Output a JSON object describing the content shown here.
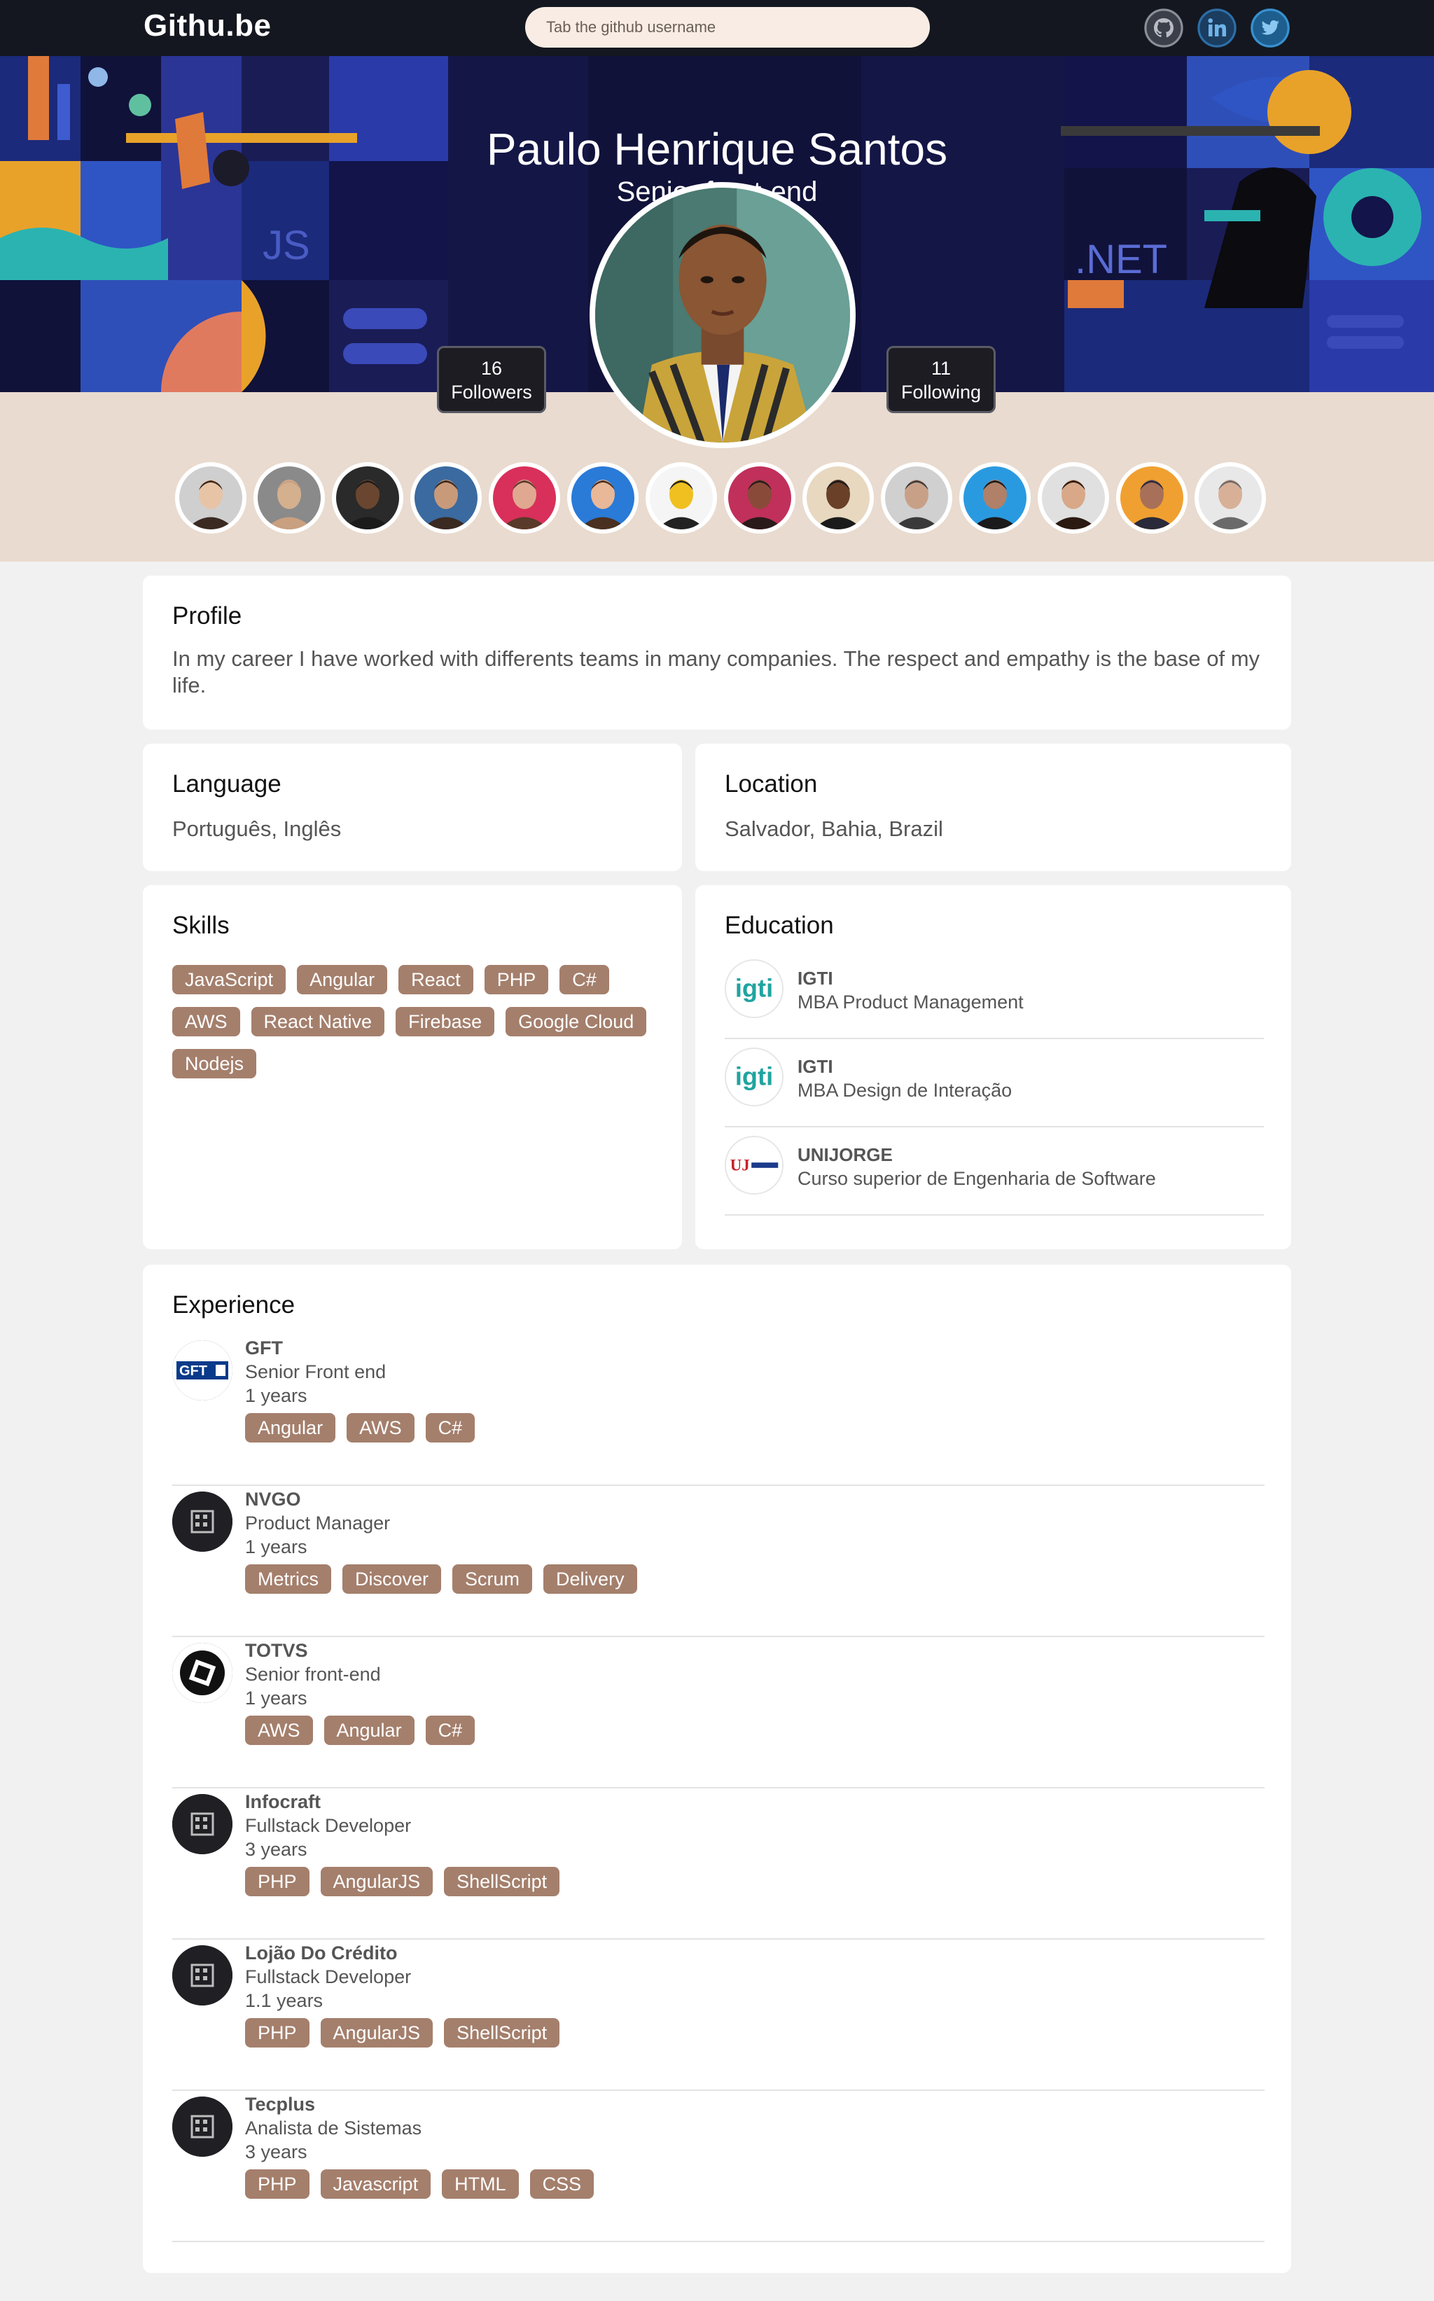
{
  "nav": {
    "brand": "Githu.be",
    "search_placeholder": "Tab the github username"
  },
  "social": [
    "github-icon",
    "linkedin-icon",
    "twitter-icon"
  ],
  "hero": {
    "name": "Paulo Henrique Santos",
    "role": "Senior front-end",
    "art_labels": [
      "JS",
      ".NET"
    ]
  },
  "stats": {
    "followers_count": "16",
    "followers_label": "Followers",
    "following_count": "11",
    "following_label": "Following"
  },
  "follower_avatars": 14,
  "profile": {
    "title": "Profile",
    "text": "In my career I have worked with differents teams in many companies. The respect and empathy is the base of my life."
  },
  "language": {
    "title": "Language",
    "value": "Português, Inglês"
  },
  "location": {
    "title": "Location",
    "value": "Salvador, Bahia, Brazil"
  },
  "skills": {
    "title": "Skills",
    "items": [
      "JavaScript",
      "Angular",
      "React",
      "PHP",
      "C#",
      "AWS",
      "React Native",
      "Firebase",
      "Google Cloud",
      "Nodejs"
    ]
  },
  "education": {
    "title": "Education",
    "items": [
      {
        "name": "IGTI",
        "course": "MBA Product Management",
        "logo_text": "igti"
      },
      {
        "name": "IGTI",
        "course": "MBA Design de Interação",
        "logo_text": "igti"
      },
      {
        "name": "UNIJORGE",
        "course": "Curso superior de Engenharia de Software",
        "logo_text": "UJ"
      }
    ]
  },
  "experience": {
    "title": "Experience",
    "items": [
      {
        "company": "GFT",
        "role": "Senior Front end",
        "years": "1 years",
        "tags": [
          "Angular",
          "AWS",
          "C#"
        ],
        "logo": "gft-logo",
        "logo_text": "GFT"
      },
      {
        "company": "NVGO",
        "role": "Product Manager",
        "years": "1 years",
        "tags": [
          "Metrics",
          "Discover",
          "Scrum",
          "Delivery"
        ],
        "logo": "building-icon"
      },
      {
        "company": "TOTVS",
        "role": "Senior front-end",
        "years": "1 years",
        "tags": [
          "AWS",
          "Angular",
          "C#"
        ],
        "logo": "totvs-logo"
      },
      {
        "company": "Infocraft",
        "role": "Fullstack Developer",
        "years": "3 years",
        "tags": [
          "PHP",
          "AngularJS",
          "ShellScript"
        ],
        "logo": "building-icon"
      },
      {
        "company": "Lojão Do Crédito",
        "role": "Fullstack Developer",
        "years": "1.1 years",
        "tags": [
          "PHP",
          "AngularJS",
          "ShellScript"
        ],
        "logo": "building-icon"
      },
      {
        "company": "Tecplus",
        "role": "Analista de Sistemas",
        "years": "3 years",
        "tags": [
          "PHP",
          "Javascript",
          "HTML",
          "CSS"
        ],
        "logo": "building-icon"
      }
    ]
  },
  "colors": {
    "nav_bg": "#14171f",
    "hero_bg": "#10123a",
    "band_bg": "#e9dbcf",
    "chip_bg": "#a47f6c",
    "page_bg": "#f1f1f1"
  }
}
